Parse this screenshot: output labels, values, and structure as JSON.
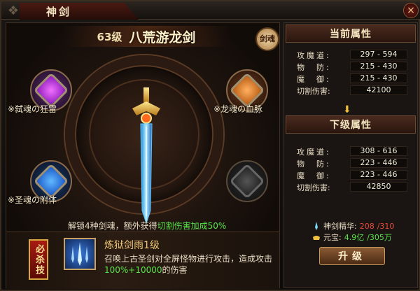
{
  "window": {
    "title": "神剑",
    "close_icon": "×"
  },
  "weapon": {
    "level": "63级",
    "name": "八荒游龙剑",
    "seal": "剑魂"
  },
  "souls": [
    {
      "label": "※弑魂の狂雷",
      "color": "#c02ad8"
    },
    {
      "label": "※龙魂の血脉",
      "color": "#d87a1a"
    },
    {
      "label": "※圣魂の附体",
      "color": "#2a78e8"
    },
    {
      "label": "",
      "color": "#444444"
    }
  ],
  "bonus": {
    "prefix": "解锁4种剑魂，额外获得",
    "highlight": "切割伤害加成50%"
  },
  "skill": {
    "badge": "必杀技",
    "name": "炼狱剑雨1级",
    "desc_prefix": "召唤上古圣剑对全屏怪物进行攻击，造成攻击",
    "desc_highlight": "100%+10000",
    "desc_suffix": "的伤害"
  },
  "current": {
    "header": "当前属性",
    "rows": [
      {
        "label": "攻魔道:",
        "value": "297 - 594"
      },
      {
        "label": "物　防:",
        "value": "215 - 430"
      },
      {
        "label": "魔　御:",
        "value": "215 - 430"
      },
      {
        "label": "切割伤害:",
        "value": "42100"
      }
    ]
  },
  "next": {
    "header": "下级属性",
    "rows": [
      {
        "label": "攻魔道:",
        "value": "308 - 616"
      },
      {
        "label": "物　防:",
        "value": "223 - 446"
      },
      {
        "label": "魔　御:",
        "value": "223 - 446"
      },
      {
        "label": "切割伤害:",
        "value": "42850"
      }
    ]
  },
  "resources": {
    "essence_label": "神剑精华:",
    "essence_have": "208",
    "essence_need": "/310",
    "gold_label": "元宝:",
    "gold_have": "4.9亿",
    "gold_need": "/305万"
  },
  "upgrade_label": "升级"
}
